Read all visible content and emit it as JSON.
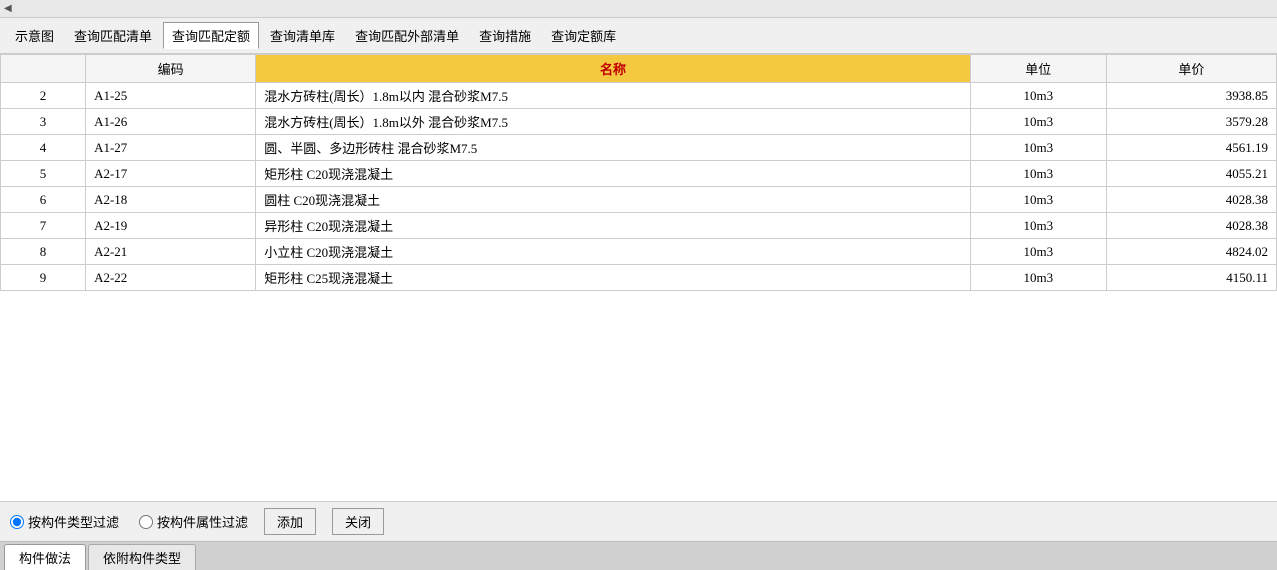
{
  "scrollbar": {
    "arrow": "◄"
  },
  "toolbar": {
    "buttons": [
      {
        "label": "示意图",
        "active": false
      },
      {
        "label": "查询匹配清单",
        "active": false
      },
      {
        "label": "查询匹配定额",
        "active": true
      },
      {
        "label": "查询清单库",
        "active": false
      },
      {
        "label": "查询匹配外部清单",
        "active": false
      },
      {
        "label": "查询措施",
        "active": false
      },
      {
        "label": "查询定额库",
        "active": false
      }
    ]
  },
  "table": {
    "headers": [
      {
        "label": "",
        "class": "num-col"
      },
      {
        "label": "编码",
        "class": "code-col"
      },
      {
        "label": "名称",
        "class": "name-col highlight"
      },
      {
        "label": "单位",
        "class": "unit-col"
      },
      {
        "label": "单价",
        "class": "price-col"
      }
    ],
    "rows": [
      {
        "num": "2",
        "code": "A1-25",
        "name": "混水方砖柱(周长）1.8m以内  混合砂浆M7.5",
        "unit": "10m3",
        "price": "3938.85"
      },
      {
        "num": "3",
        "code": "A1-26",
        "name": "混水方砖柱(周长）1.8m以外  混合砂浆M7.5",
        "unit": "10m3",
        "price": "3579.28"
      },
      {
        "num": "4",
        "code": "A1-27",
        "name": "圆、半圆、多边形砖柱  混合砂浆M7.5",
        "unit": "10m3",
        "price": "4561.19"
      },
      {
        "num": "5",
        "code": "A2-17",
        "name": "矩形柱  C20现浇混凝土",
        "unit": "10m3",
        "price": "4055.21"
      },
      {
        "num": "6",
        "code": "A2-18",
        "name": "圆柱  C20现浇混凝土",
        "unit": "10m3",
        "price": "4028.38"
      },
      {
        "num": "7",
        "code": "A2-19",
        "name": "异形柱  C20现浇混凝土",
        "unit": "10m3",
        "price": "4028.38"
      },
      {
        "num": "8",
        "code": "A2-21",
        "name": "小立柱  C20现浇混凝土",
        "unit": "10m3",
        "price": "4824.02"
      },
      {
        "num": "9",
        "code": "A2-22",
        "name": "矩形柱  C25现浇混凝土",
        "unit": "10m3",
        "price": "4150.11"
      }
    ]
  },
  "footer": {
    "radio1_label": "按构件类型过滤",
    "radio2_label": "按构件属性过滤",
    "add_btn": "添加",
    "close_btn": "关闭"
  },
  "tabs": [
    {
      "label": "构件做法",
      "active": true
    },
    {
      "label": "依附构件类型",
      "active": false
    }
  ]
}
